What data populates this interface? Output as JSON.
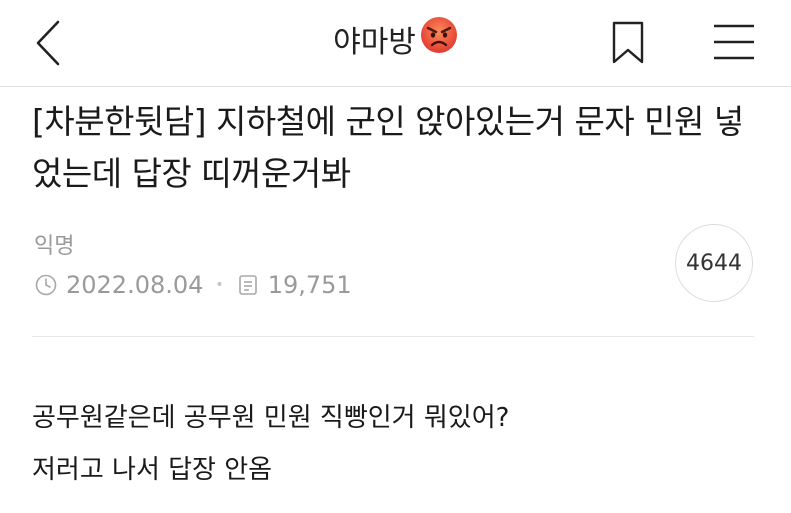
{
  "header": {
    "title": "야마방",
    "back_icon": "chevron-left-icon",
    "emoji_icon": "angry-face-icon",
    "bookmark_icon": "bookmark-icon",
    "menu_icon": "hamburger-menu-icon"
  },
  "post": {
    "title": "[차분한뒷담] 지하철에 군인 앉아있는거 문자 민원 넣었는데 답장 띠꺼운거봐",
    "author": "익명",
    "date": "2022.08.04",
    "views": "19,751",
    "comment_count": "4644",
    "body_lines": [
      "공무원같은데 공무원 민원 직빵인거 뭐있어?",
      "저러고 나서 답장 안옴"
    ]
  },
  "colors": {
    "emoji_red": "#e8483b",
    "meta_gray": "#9a9a9a",
    "divider": "#e6e6e6"
  }
}
